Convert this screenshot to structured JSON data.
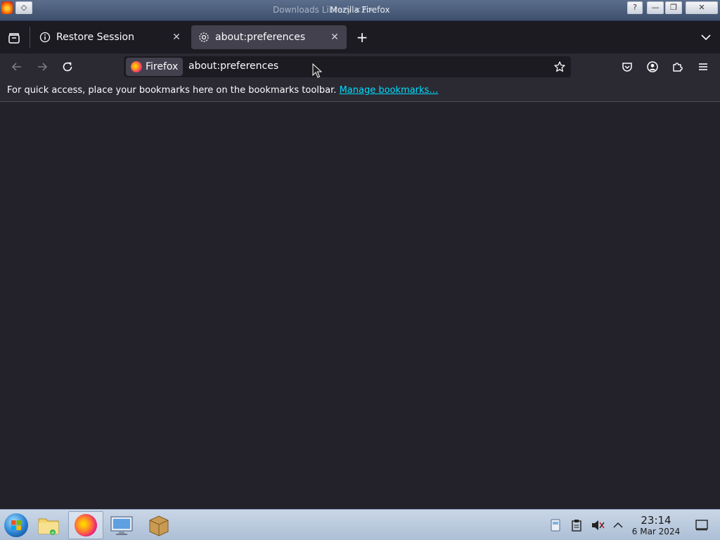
{
  "window": {
    "title": "Mozilla Firefox",
    "title_ghost": "Downloads Library <2>",
    "buttons": {
      "help": "?",
      "minimize": "—",
      "maximize": "❐",
      "close": "✕"
    }
  },
  "tabs": [
    {
      "label": "Restore Session",
      "icon": "info-icon",
      "active": false
    },
    {
      "label": "about:preferences",
      "icon": "gear-icon",
      "active": true
    }
  ],
  "newtab_label": "+",
  "navbar": {
    "identity_label": "Firefox",
    "url": "about:preferences"
  },
  "bookmarks_bar": {
    "message": "For quick access, place your bookmarks here on the bookmarks toolbar.",
    "link": "Manage bookmarks…"
  },
  "taskbar": {
    "clock_time": "23:14",
    "clock_date": "6 Mar 2024",
    "apps": [
      "start-button",
      "file-manager",
      "firefox",
      "remote-desktop",
      "package-manager"
    ]
  },
  "colors": {
    "link": "#00ddff",
    "toolbar": "#2b2a33",
    "content": "#23222b"
  }
}
